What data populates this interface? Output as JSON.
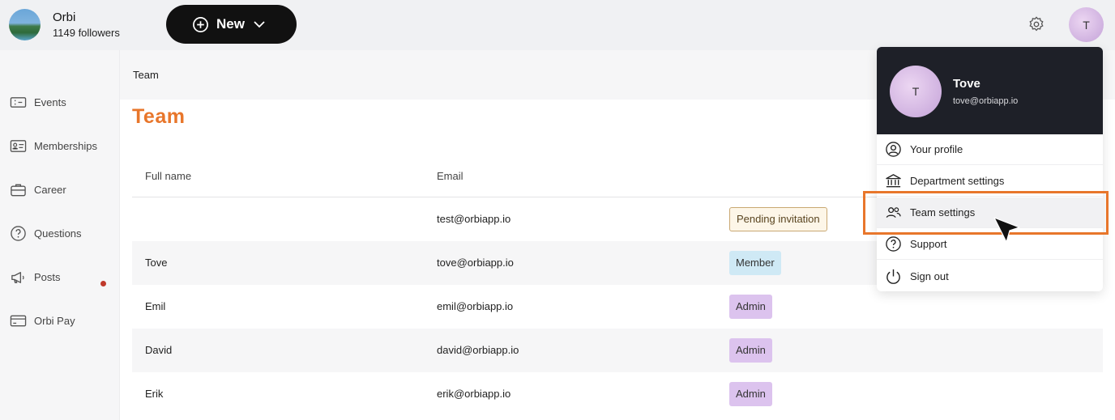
{
  "org": {
    "name": "Orbi",
    "followers": "1149 followers"
  },
  "toolbar": {
    "new_label": "New"
  },
  "user": {
    "initial": "T",
    "name": "Tove",
    "email": "tove@orbiapp.io"
  },
  "sidebar": {
    "items": [
      {
        "label": "Events",
        "icon": "ticket-icon"
      },
      {
        "label": "Memberships",
        "icon": "id-card-icon"
      },
      {
        "label": "Career",
        "icon": "briefcase-icon"
      },
      {
        "label": "Questions",
        "icon": "question-circle-icon"
      },
      {
        "label": "Posts",
        "icon": "megaphone-icon"
      },
      {
        "label": "Orbi Pay",
        "icon": "credit-card-icon"
      }
    ]
  },
  "breadcrumb": "Team",
  "page": {
    "title": "Team"
  },
  "table": {
    "headers": {
      "full_name": "Full name",
      "email": "Email"
    },
    "rows": [
      {
        "name": "",
        "email": "test@orbiapp.io",
        "role": "Pending invitation"
      },
      {
        "name": "Tove",
        "email": "tove@orbiapp.io",
        "role": "Member"
      },
      {
        "name": "Emil",
        "email": "emil@orbiapp.io",
        "role": "Admin"
      },
      {
        "name": "David",
        "email": "david@orbiapp.io",
        "role": "Admin"
      },
      {
        "name": "Erik",
        "email": "erik@orbiapp.io",
        "role": "Admin"
      }
    ]
  },
  "menu": {
    "items": [
      {
        "label": "Your profile",
        "icon": "user-circle-icon"
      },
      {
        "label": "Department settings",
        "icon": "bank-icon"
      },
      {
        "label": "Team settings",
        "icon": "users-icon"
      },
      {
        "label": "Support",
        "icon": "question-circle-icon"
      },
      {
        "label": "Sign out",
        "icon": "power-icon"
      }
    ]
  },
  "colors": {
    "accent": "#e8762b",
    "dark": "#1e2028",
    "member": "#cfe9f5",
    "admin": "#dcc3ee"
  }
}
